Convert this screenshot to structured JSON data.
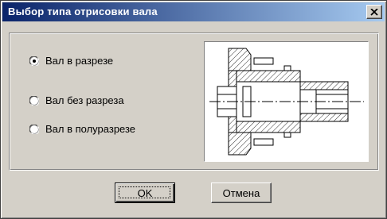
{
  "window": {
    "title": "Выбор типа отрисовки вала",
    "close_icon": "close-icon"
  },
  "options": {
    "items": [
      {
        "label": "Вал в разрезе",
        "checked": true
      },
      {
        "label": "Вал без разреза",
        "checked": false
      },
      {
        "label": "Вал в полуразрезе",
        "checked": false
      }
    ]
  },
  "preview": {
    "icon": "shaft-drawing-icon"
  },
  "buttons": {
    "ok_label": "OK",
    "cancel_label": "Отмена"
  },
  "colors": {
    "titlebar_start": "#0a246a",
    "titlebar_end": "#a6caf0",
    "face": "#d4d0c8"
  }
}
